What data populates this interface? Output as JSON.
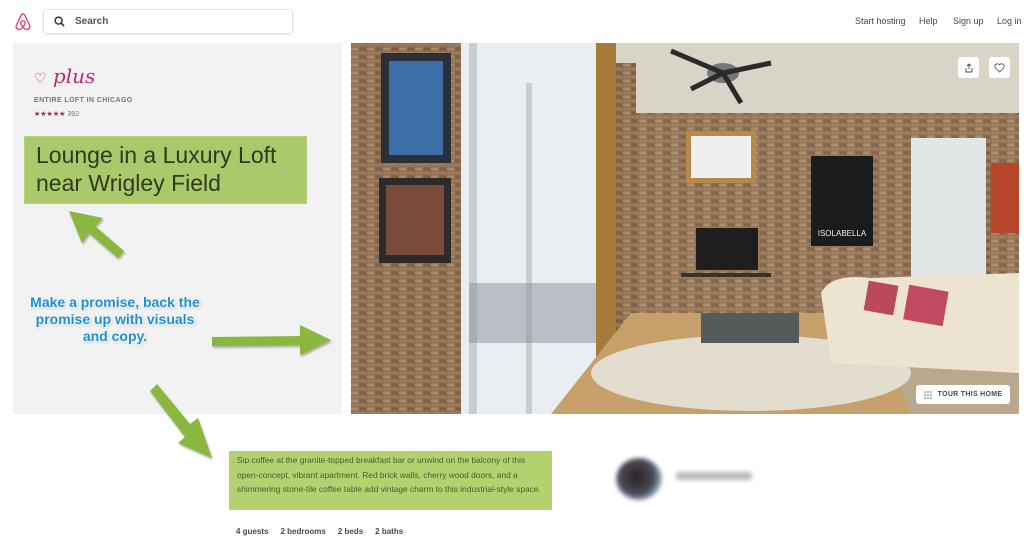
{
  "header": {
    "search_placeholder": "Search",
    "nav": [
      "Start hosting",
      "Help",
      "Sign up",
      "Log in"
    ]
  },
  "listing": {
    "brand_badge": "plus",
    "type": "ENTIRE LOFT IN CHICAGO",
    "stars": "★★★★★",
    "review_count": "392",
    "title": "Lounge in a Luxury Loft near Wrigley Field",
    "description": "Sip coffee at the granite-topped breakfast bar or unwind on the balcony of this open-concept, vibrant apartment. Red brick walls, cherry wood doors, and a shimmering stone-tile coffee table add vintage charm to this industrial-style space.",
    "facts": [
      "4 guests",
      "2 bedrooms",
      "2 beds",
      "2 baths"
    ],
    "tour_label": "TOUR THIS HOME",
    "poster_text": "ISOLABELLA"
  },
  "annotation": {
    "text": "Make a promise, back the promise up with visuals and copy.",
    "color": "#1c8fd6",
    "arrow_color": "#8ab83f",
    "highlight_color": "#a9c96a"
  },
  "icons": {
    "logo": "airbnb-logo",
    "search": "search-icon",
    "share": "share-icon",
    "save": "heart-icon",
    "tour": "grid-icon"
  },
  "colors": {
    "brand": "#c3296b"
  }
}
